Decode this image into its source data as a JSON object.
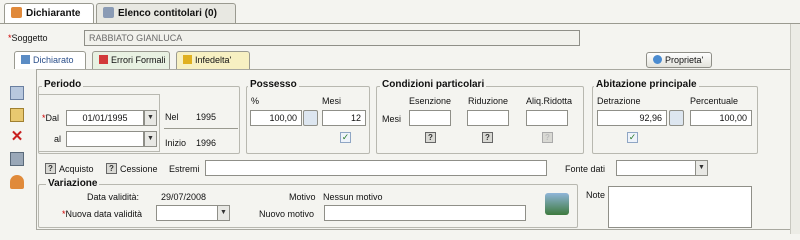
{
  "tabs": [
    {
      "label": "Dichiarante"
    },
    {
      "label": "Elenco contitolari (0)"
    }
  ],
  "soggetto": {
    "label": "Soggetto",
    "value": "RABBIATO GIANLUCA"
  },
  "subtabs": [
    {
      "label": "Dichiarato"
    },
    {
      "label": "Errori Formali"
    },
    {
      "label": "Infedelta'"
    }
  ],
  "proprieta_label": "Proprieta'",
  "periodo": {
    "title": "Periodo",
    "dal_label": "Dal",
    "dal_value": "01/01/1995",
    "al_label": "al",
    "al_value": "",
    "nel_label": "Nel",
    "nel_value": "1995",
    "inizio_label": "Inizio",
    "inizio_value": "1996"
  },
  "possesso": {
    "title": "Possesso",
    "pct_label": "%",
    "mesi_label": "Mesi",
    "pct_value": "100,00",
    "mesi_value": "12"
  },
  "condizioni": {
    "title": "Condizioni particolari",
    "col_esenzione": "Esenzione",
    "col_riduzione": "Riduzione",
    "col_aliq": "Aliq.Ridotta",
    "mesi_label": "Mesi"
  },
  "abitazione": {
    "title": "Abitazione principale",
    "detrazione_label": "Detrazione",
    "percentuale_label": "Percentuale",
    "detrazione_value": "92,96",
    "percentuale_value": "100,00"
  },
  "row": {
    "acquisto": "Acquisto",
    "cessione": "Cessione",
    "estremi": "Estremi",
    "fonte_dati": "Fonte dati"
  },
  "variazione": {
    "title": "Variazione",
    "data_validita_label": "Data validità:",
    "data_validita_value": "29/07/2008",
    "motivo_label": "Motivo",
    "motivo_value": "Nessun motivo",
    "nuova_data_label": "Nuova data validità",
    "nuovo_motivo_label": "Nuovo motivo"
  },
  "note_label": "Note",
  "colors": {
    "required": "#d00000",
    "accent": "#2b6fb5"
  }
}
